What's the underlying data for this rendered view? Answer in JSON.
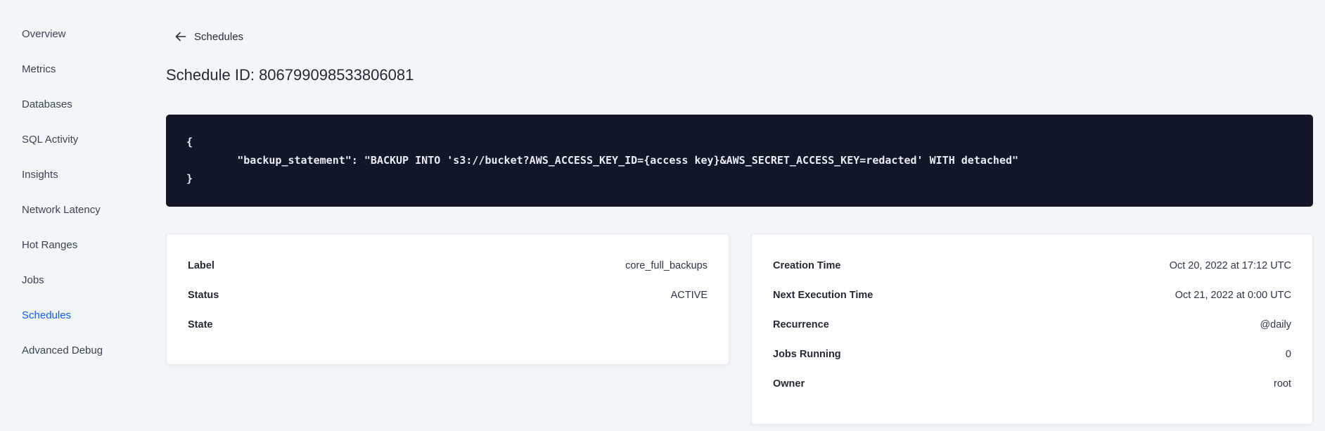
{
  "sidebar": {
    "items": [
      {
        "label": "Overview",
        "active": false
      },
      {
        "label": "Metrics",
        "active": false
      },
      {
        "label": "Databases",
        "active": false
      },
      {
        "label": "SQL Activity",
        "active": false
      },
      {
        "label": "Insights",
        "active": false
      },
      {
        "label": "Network Latency",
        "active": false
      },
      {
        "label": "Hot Ranges",
        "active": false
      },
      {
        "label": "Jobs",
        "active": false
      },
      {
        "label": "Schedules",
        "active": true
      },
      {
        "label": "Advanced Debug",
        "active": false
      }
    ]
  },
  "header": {
    "back_label": "Schedules",
    "back_icon": "left-arrow-icon",
    "title": "Schedule ID: 806799098533806081"
  },
  "code_block": {
    "text": "{\n        \"backup_statement\": \"BACKUP INTO 's3://bucket?AWS_ACCESS_KEY_ID={access key}&AWS_SECRET_ACCESS_KEY=redacted' WITH detached\"\n}"
  },
  "details_left": {
    "rows": [
      {
        "label": "Label",
        "value": "core_full_backups"
      },
      {
        "label": "Status",
        "value": "ACTIVE"
      },
      {
        "label": "State",
        "value": ""
      }
    ]
  },
  "details_right": {
    "rows": [
      {
        "label": "Creation Time",
        "value": "Oct 20, 2022 at 17:12 UTC"
      },
      {
        "label": "Next Execution Time",
        "value": "Oct 21, 2022 at 0:00 UTC"
      },
      {
        "label": "Recurrence",
        "value": "@daily"
      },
      {
        "label": "Jobs Running",
        "value": "0"
      },
      {
        "label": "Owner",
        "value": "root"
      }
    ]
  },
  "colors": {
    "page_bg": "#f3f6f9",
    "accent_blue": "#0b5cff",
    "code_bg": "#111726",
    "code_text": "#e7ecf3",
    "text_dark": "#242a35",
    "text_slate": "#394455",
    "card_bg": "#ffffff",
    "card_border": "#e7eaf1"
  }
}
